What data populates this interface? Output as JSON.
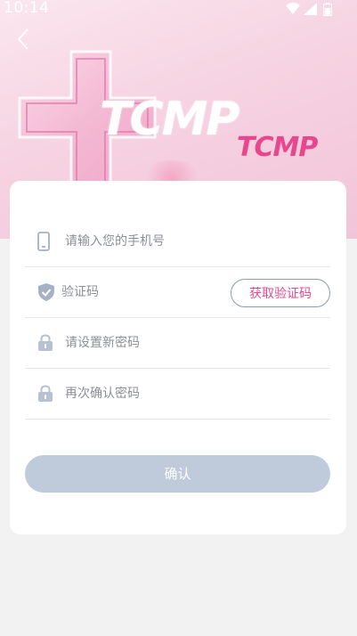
{
  "status_bar": {
    "time": "10:14"
  },
  "hero": {
    "logo_primary": "TCMP",
    "logo_secondary": "TCMP",
    "brand_color": "#e8478d"
  },
  "form": {
    "phone": {
      "placeholder": "请输入您的手机号",
      "icon": "phone-icon"
    },
    "code": {
      "placeholder": "验证码",
      "icon": "shield-check-icon",
      "get_code_label": "获取验证码"
    },
    "new_password": {
      "placeholder": "请设置新密码",
      "icon": "lock-icon"
    },
    "confirm_password": {
      "placeholder": "再次确认密码",
      "icon": "lock-icon"
    },
    "confirm_label": "确认",
    "confirm_color": "#bfcadb"
  }
}
